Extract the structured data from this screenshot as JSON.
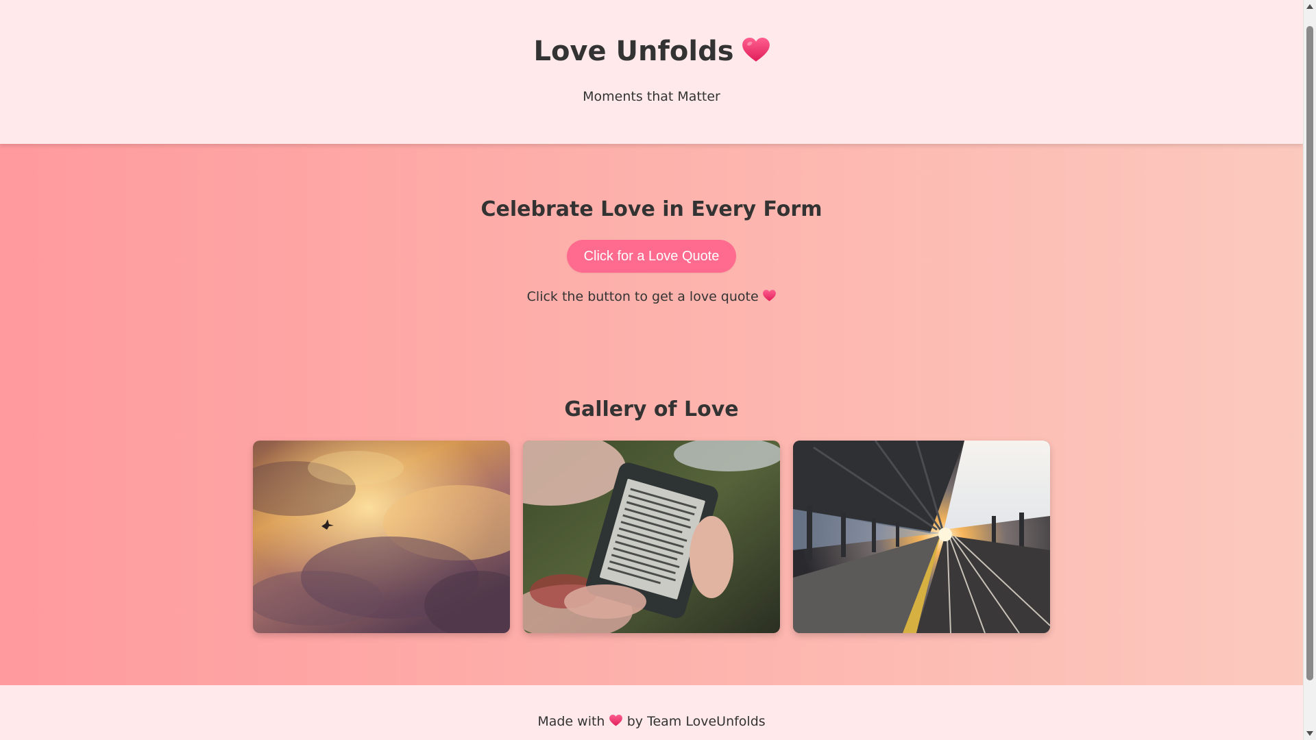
{
  "header": {
    "title": "Love Unfolds",
    "title_icon": "heart-emoji",
    "tagline": "Moments that Matter"
  },
  "celebrate": {
    "title": "Celebrate Love in Every Form",
    "button_label": "Click for a Love Quote",
    "quote_text": "Click the button to get a love quote",
    "quote_icon": "heart-emoji"
  },
  "gallery": {
    "title": "Gallery of Love",
    "images": [
      {
        "subject": "bird flying among golden sunset clouds"
      },
      {
        "subject": "hands holding an e-reader"
      },
      {
        "subject": "covered train platform at sunset"
      }
    ]
  },
  "footer": {
    "made_with": "Made with",
    "by_team": "by Team LoveUnfolds",
    "icon": "heart-emoji"
  },
  "colors": {
    "header_bg": "#ffe9ea",
    "main_gradient_start": "#ff9a9e",
    "main_gradient_end": "#fcc9be",
    "button_bg": "#ff6b8e",
    "heart": "#f0306a",
    "text": "#333333"
  }
}
